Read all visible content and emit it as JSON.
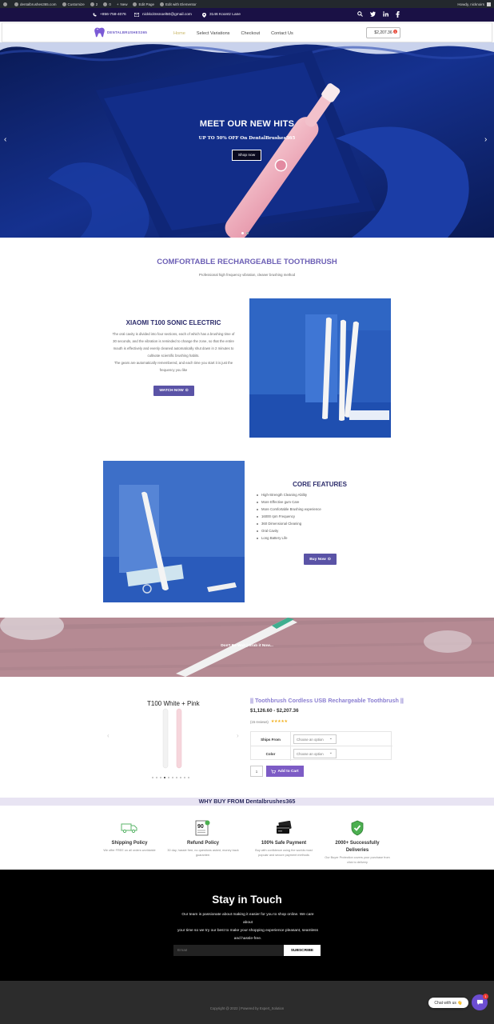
{
  "admin_bar": {
    "site": "dentalbrushes365.com",
    "customize": "Customize",
    "comments": "0",
    "updates": "2",
    "new": "New",
    "edit_page": "Edit Page",
    "elementor": "Edit with Elementor",
    "howdy": "Howdy, nicknoirs"
  },
  "topbar": {
    "phone": "+856-758-4076",
    "email": "nickkcitnsnoel50@gmail.com",
    "address": "3146 Koontz Lane",
    "icons": [
      "search-icon",
      "twitter-icon",
      "linkedin-icon",
      "facebook-icon"
    ]
  },
  "header": {
    "logo_text": "DENTALBRUSHES365",
    "nav": [
      "Home",
      "Select Variations",
      "Checkout",
      "Contact Us"
    ],
    "active_nav": "Home",
    "cart_total": "$2,207.36",
    "cart_count": "1"
  },
  "hero": {
    "title": "MEET OUR NEW HITS",
    "subtitle": "UP TO 50% OFF On DentalBrushes365",
    "button": "Shop now",
    "prev": "‹",
    "next": "›"
  },
  "section1": {
    "title": "COMFORTABLE RECHARGEABLE TOOTHBRUSH",
    "subtitle": "Professional high frequency vibration, cleaner brushing method"
  },
  "feature1": {
    "title": "XIAOMI T100 SONIC ELECTRIC",
    "lines": [
      "The oral cavity is divided into four sections, each of which has a brushing time of",
      "30 seconds, and the vibration is reminded to change the zone, so that the entire",
      "mouth is effectively and evenly cleaned automatically shut down in 2 minutes to",
      "cultivate scientific brushing habits.",
      "The gears are automatically remembered, and each time you start it is just the",
      "frequency you like"
    ],
    "button": "WATCH NOW"
  },
  "feature2": {
    "title": "CORE FEATURES",
    "items": [
      "High-Strength Cleaning Ability",
      "More Effective gum Care",
      "More Comfortable Brushing experience",
      "16000 rpm Frequency",
      "360 Dimensional Cleaning",
      "Oral Cavity",
      "Long Battery Life"
    ],
    "button": "Buy Now"
  },
  "banner": {
    "text": "Don't Be Wait | Grab it Now..."
  },
  "product": {
    "gallery_caption": "T100 White + Pink",
    "title": "|| Toothbrush Cordless USB Rechargeable Toothbrush ||",
    "price": "$1,126.60 - $2,207.36",
    "reviews": "(15 reviews)",
    "stars": "★★★★★",
    "variations": [
      {
        "label": "Ships From",
        "placeholder": "Choose an option"
      },
      {
        "label": "Color",
        "placeholder": "Choose an option"
      }
    ],
    "qty": "1",
    "add_to_cart": "Add to Cart"
  },
  "why": {
    "title": "WHY BUY FROM Dentalbrushes365",
    "items": [
      {
        "title": "Shipping Policy",
        "desc": [
          "We offer FREE on all orders worldwide"
        ]
      },
      {
        "title": "Refund Policy",
        "desc": [
          "30 day, hassle free, no questions asked, money back",
          "guarantee."
        ]
      },
      {
        "title": "100% Safe Payment",
        "desc": [
          "Buy with confidence using the worlds most",
          "popular and secure payment methods"
        ]
      },
      {
        "title": "2000+ Successfully Deliveries",
        "title_lines": [
          "2000+ Successfully",
          "Deliveries"
        ],
        "desc": [
          "Our Buyer Protection covers your purchase from",
          "click to delivery"
        ]
      }
    ]
  },
  "stay": {
    "title": "Stay in Touch",
    "lines": [
      "Our team is passionate about making it easier for you to shop online. We care about",
      "your time so we try our best to make your shopping experience pleasant, seamless",
      "and hassle-free."
    ],
    "email_placeholder": "Email",
    "subscribe": "SUBSCRIBE"
  },
  "footer": {
    "copyright": "Copyright @ 2022 | Powered by Expert_Solution"
  },
  "chat": {
    "label": "Chat with us 👋",
    "badge": "1"
  },
  "colors": {
    "topbar": "#1a1145",
    "hero": "#0c1d5e",
    "accent_purple": "#5a53a6",
    "title_purple": "#6c5fb5"
  }
}
